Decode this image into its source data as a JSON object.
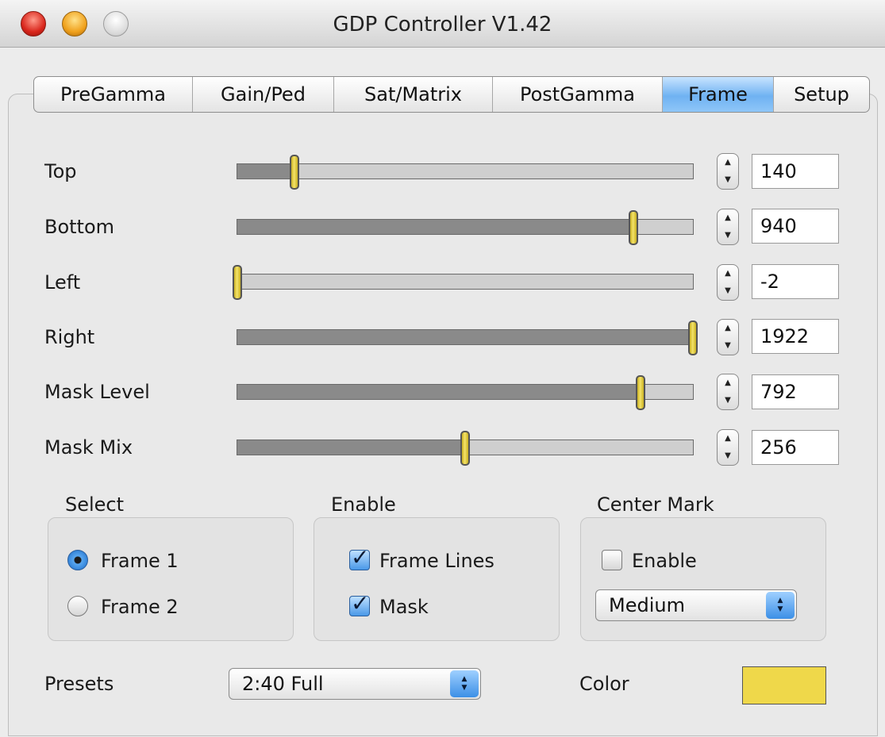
{
  "window": {
    "title": "GDP Controller V1.42"
  },
  "tabs": [
    {
      "label": "PreGamma"
    },
    {
      "label": "Gain/Ped"
    },
    {
      "label": "Sat/Matrix"
    },
    {
      "label": "PostGamma"
    },
    {
      "label": "Frame",
      "active": true
    },
    {
      "label": "Setup"
    }
  ],
  "sliders": [
    {
      "label": "Top",
      "value": "140",
      "level": 0.125
    },
    {
      "label": "Bottom",
      "value": "940",
      "level": 0.87
    },
    {
      "label": "Left",
      "value": "-2",
      "level": 0.0
    },
    {
      "label": "Right",
      "value": "1922",
      "level": 1.0
    },
    {
      "label": "Mask Level",
      "value": "792",
      "level": 0.885
    },
    {
      "label": "Mask Mix",
      "value": "256",
      "level": 0.5
    }
  ],
  "select_group": {
    "title": "Select",
    "options": [
      {
        "label": "Frame 1",
        "selected": true
      },
      {
        "label": "Frame 2",
        "selected": false
      }
    ]
  },
  "enable_group": {
    "title": "Enable",
    "options": [
      {
        "label": "Frame Lines",
        "checked": true
      },
      {
        "label": "Mask",
        "checked": true
      }
    ]
  },
  "center_mark_group": {
    "title": "Center Mark",
    "enable_label": "Enable",
    "enable_checked": false,
    "size_value": "Medium"
  },
  "presets": {
    "label": "Presets",
    "value": "2:40 Full"
  },
  "color": {
    "label": "Color",
    "swatch": "#efd84a"
  },
  "colors": {
    "active_tab": "#6fb2f2",
    "slider_thumb": "#f4e36a"
  }
}
